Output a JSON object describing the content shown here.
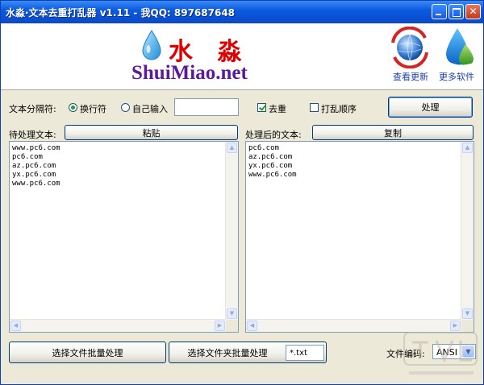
{
  "window": {
    "title": "水淼·文本去重打乱器 v1.11 - 我QQ: 897687648"
  },
  "header": {
    "logo_cn": "水 淼",
    "logo_en": "ShuiMiao.net",
    "check_update_label": "查看更新",
    "more_software_label": "更多软件"
  },
  "options": {
    "separator_label": "文本分隔符:",
    "newline_label": "换行符",
    "custom_label": "自己输入",
    "custom_value": "",
    "dedupe_label": "去重",
    "shuffle_label": "打乱顺序",
    "process_label": "处理",
    "newline_selected": true,
    "dedupe_checked": true,
    "shuffle_checked": false
  },
  "input_panel": {
    "label": "待处理文本:",
    "paste_label": "粘贴",
    "lines": [
      "www.pc6.com",
      "pc6.com",
      "az.pc6.com",
      "yx.pc6.com",
      "www.pc6.com"
    ]
  },
  "output_panel": {
    "label": "处理后的文本:",
    "copy_label": "复制",
    "lines": [
      "pc6.com",
      "az.pc6.com",
      "yx.pc6.com",
      "www.pc6.com"
    ]
  },
  "footer": {
    "batch_file_label": "选择文件批量处理",
    "batch_folder_label": "选择文件夹批量处理",
    "ext_value": "*.txt",
    "encoding_label": "文件编码:",
    "encoding_value": "ANSI"
  },
  "colors": {
    "titlebar": "#0b5be0",
    "logo_red": "#e00000",
    "logo_purple": "#5a1a9a",
    "link_blue": "#1c3fa6",
    "check_green": "#21a121"
  }
}
